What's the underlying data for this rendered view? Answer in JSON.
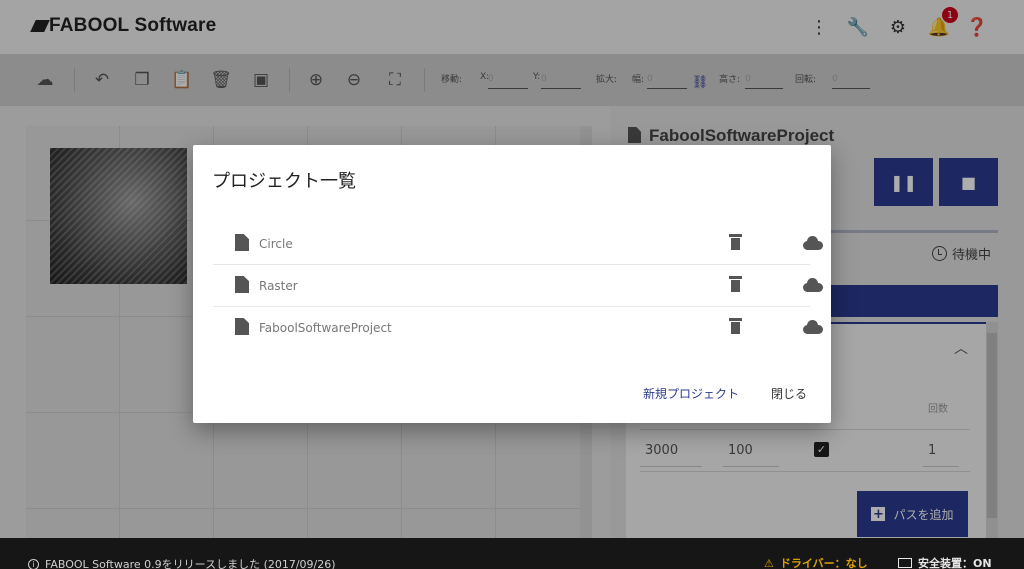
{
  "header": {
    "logo": "FABOOL Software",
    "notification_count": "1"
  },
  "toolbar": {
    "move_label": "移動:",
    "x_label": "X:",
    "x_value": "0",
    "y_label": "Y:",
    "y_value": "0",
    "scale_label": "拡大:",
    "width_label": "幅:",
    "width_value": "0",
    "height_label": "高さ:",
    "height_value": "0",
    "rotate_label": "回転:",
    "rotate_value": "0"
  },
  "right_panel": {
    "project_title": "FaboolSoftwareProject",
    "pause_icon": "pause-icon",
    "stop_icon": "stop-icon",
    "status": "待機中",
    "col_count": "回数",
    "speed": "3000",
    "power": "100",
    "count": "1",
    "add_pass": "パスを追加"
  },
  "modal": {
    "title": "プロジェクト一覧",
    "projects": [
      {
        "name": "Circle"
      },
      {
        "name": "Raster"
      },
      {
        "name": "FaboolSoftwareProject"
      }
    ],
    "new_project": "新規プロジェクト",
    "close": "閉じる"
  },
  "footer": {
    "info": "FABOOL Software 0.9をリリースしました (2017/09/26)",
    "driver": "ドライバー：なし",
    "safety": "安全装置：ON"
  },
  "colors": {
    "accent": "#2b3a8f",
    "warning": "#d9a300",
    "badge": "#d0021b"
  }
}
